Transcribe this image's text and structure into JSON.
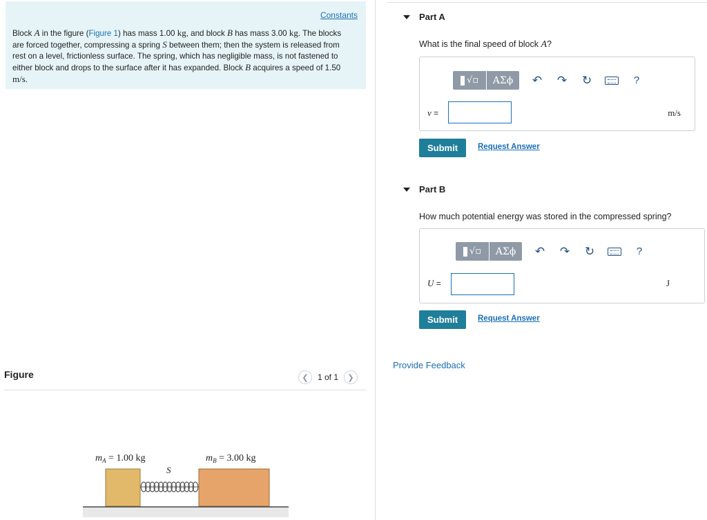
{
  "problem": {
    "constants_link": "Constants",
    "figure_link": "Figure 1",
    "t1": "Block",
    "var_A": "A",
    "t2": "in the figure (",
    "t3": ") has mass 1.00",
    "kg": "kg",
    "t4": ", and block",
    "var_B": "B",
    "t5": "has mass 3.00",
    "t6": ". The blocks are forced together, compressing a spring",
    "var_S": "S",
    "t7": "between them; then the system is released from rest on a level, frictionless surface. The spring, which has negligible mass, is not fastened to either block and drops to the surface after it has expanded. Block",
    "t8": "acquires a speed of 1.50",
    "ms": "m/s",
    "t9": "."
  },
  "figure": {
    "label": "Figure",
    "pager_text": "1 of 1",
    "prev_icon": "chevron-left-icon",
    "next_icon": "chevron-right-icon",
    "mass_a_label": "m",
    "mass_a_sub": "A",
    "mass_a_value": " = 1.00 kg",
    "mass_b_label": "m",
    "mass_b_sub": "B",
    "mass_b_value": " = 3.00 kg",
    "spring_label": "S",
    "block_a_color": "#e2b96a",
    "block_b_color": "#e6a46b"
  },
  "partA": {
    "title": "Part A",
    "question_pre": "What is the final speed of block ",
    "question_var": "A",
    "question_post": "?",
    "var": "v",
    "eq": " =",
    "unit": "m/s",
    "input_value": "",
    "submit": "Submit",
    "request": "Request Answer"
  },
  "partB": {
    "title": "Part B",
    "question": "How much potential energy was stored in the compressed spring?",
    "var": "U",
    "eq": " =",
    "unit": "J",
    "input_value": "",
    "submit": "Submit",
    "request": "Request Answer"
  },
  "toolbar": {
    "greek": "ΑΣϕ",
    "sqrt_glyph": "√▫",
    "undo_icon": "undo-icon",
    "redo_icon": "redo-icon",
    "reset_icon": "reset-icon",
    "keyboard_icon": "keyboard-icon",
    "help": "?"
  },
  "feedback": "Provide Feedback",
  "colors": {
    "accent": "#1a6fb3",
    "submit_bg": "#1f7e9a",
    "problem_bg": "#e6f4f7"
  }
}
